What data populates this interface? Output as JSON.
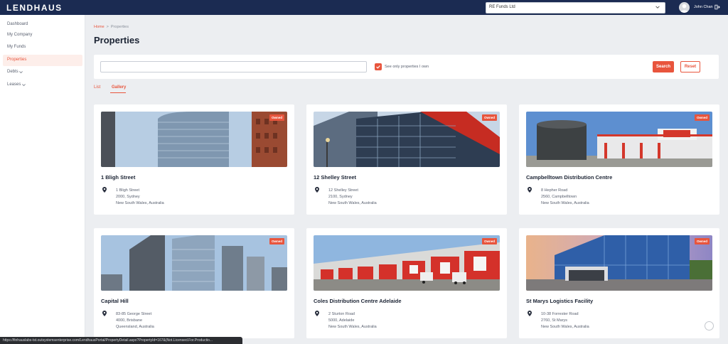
{
  "app": {
    "logo": "LENDHAUS"
  },
  "header": {
    "fund_selector": {
      "value": "RE Funds Ltd",
      "icon": "chevron-down-icon"
    },
    "user": {
      "name": "John Chan",
      "avatar_icon": "user-avatar-icon",
      "logout_icon": "logout-icon"
    }
  },
  "sidebar": {
    "items": [
      {
        "label": "Dashboard",
        "active": false
      },
      {
        "label": "My Company",
        "active": false
      },
      {
        "label": "My Funds",
        "active": false
      },
      {
        "label": "Properties",
        "active": true
      },
      {
        "label": "Debts",
        "active": false,
        "expandable": true
      },
      {
        "label": "Leases",
        "active": false,
        "expandable": true
      }
    ]
  },
  "breadcrumb": {
    "home": "Home",
    "separator": ">",
    "current": "Properties"
  },
  "page": {
    "title": "Properties"
  },
  "filters": {
    "search_value": "",
    "own_only_label": "See only properties I own",
    "own_only_checked": true,
    "search_button": "Search",
    "reset_button": "Reset"
  },
  "tabs": [
    {
      "label": "List",
      "active": false
    },
    {
      "label": "Gallery",
      "active": true
    }
  ],
  "properties": [
    {
      "name": "1 Bligh Street",
      "badge": "Owned",
      "street": "1 Bligh Street",
      "postcode_city": "2000, Sydney",
      "state_country": "New South Wales, Australia"
    },
    {
      "name": "12 Shelley Street",
      "badge": "Owned",
      "street": "12 Shelley Street",
      "postcode_city": "2100, Sydney",
      "state_country": "New South Wales, Australia"
    },
    {
      "name": "Campbelltown Distribution Centre",
      "badge": "Owned",
      "street": "8 Hepher Road",
      "postcode_city": "2560, Campbelltown",
      "state_country": "New South Wales, Australia"
    },
    {
      "name": "Capital Hill",
      "badge": "Owned",
      "street": "83-85 George Street",
      "postcode_city": "4000, Brisbane",
      "state_country": "Queensland, Australia"
    },
    {
      "name": "Coles Distribution Centre Adelaide",
      "badge": "Owned",
      "street": "2 Sturton Road",
      "postcode_city": "5000, Adelaide",
      "state_country": "New South Wales, Australia"
    },
    {
      "name": "St Marys Logistics Facility",
      "badge": "Owned",
      "street": "10-38 Forrester Road",
      "postcode_city": "2760, St Marys",
      "state_country": "New South Wales, Australia"
    }
  ],
  "status_bar": {
    "url": "https://finhauslabs-tst.outsystemsenterprise.com/LendhausPortal/PropertyDetail.aspx?PropertyId=167&(Not.Licensed.For.Productio..."
  },
  "colors": {
    "brand_navy": "#1b2b52",
    "accent": "#e8553d",
    "background": "#eceef1"
  }
}
